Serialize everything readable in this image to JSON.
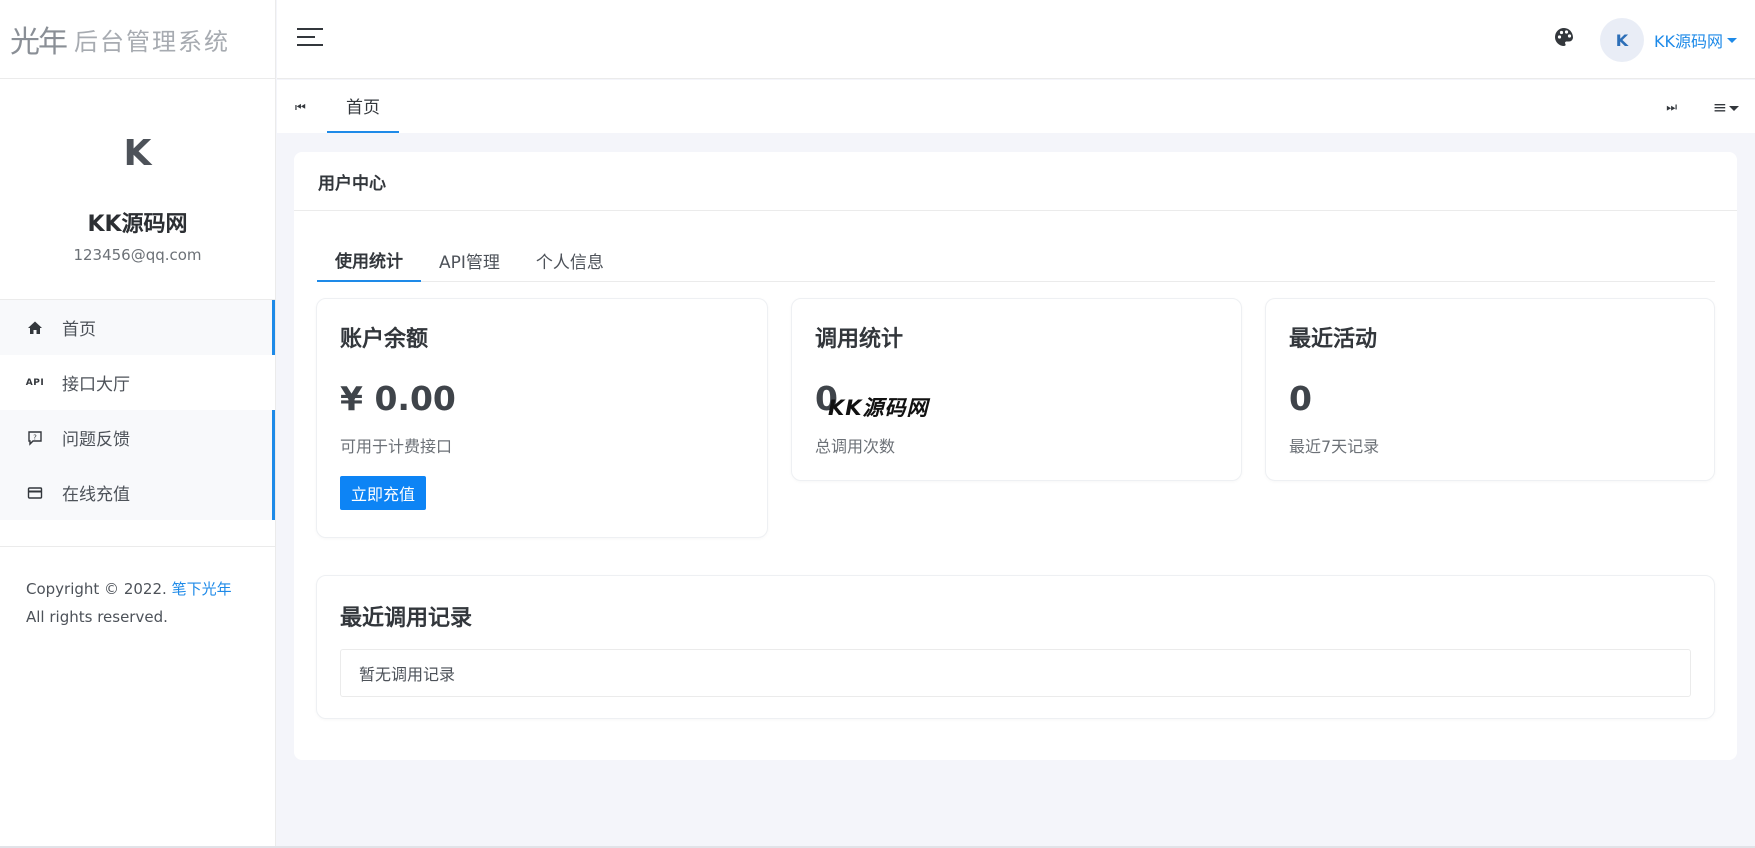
{
  "logo": {
    "glyph": "光年",
    "text": "后台管理系统"
  },
  "profile": {
    "initial": "K",
    "name": "KK源码网",
    "email": "123456@qq.com"
  },
  "sidebar": {
    "items": [
      {
        "label": "首页",
        "icon": "home-icon"
      },
      {
        "label": "接口大厅",
        "icon": "api-icon",
        "icon_text": "API"
      },
      {
        "label": "问题反馈",
        "icon": "feedback-icon"
      },
      {
        "label": "在线充值",
        "icon": "card-icon"
      }
    ]
  },
  "copyright": {
    "prefix": "Copyright © 2022.",
    "link": "笔下光年",
    "suffix": "All rights reserved."
  },
  "header": {
    "user_initial": "K",
    "user_name": "KK源码网"
  },
  "tabbar": {
    "prev": "⏮",
    "tab": "首页",
    "next": "⏭",
    "menu": "≡"
  },
  "panel": {
    "title": "用户中心"
  },
  "subtabs": [
    "使用统计",
    "API管理",
    "个人信息"
  ],
  "cards": {
    "balance": {
      "title": "账户余额",
      "value": "¥ 0.00",
      "desc": "可用于计费接口",
      "button": "立即充值"
    },
    "calls": {
      "title": "调用统计",
      "value": "0",
      "desc": "总调用次数"
    },
    "activity": {
      "title": "最近活动",
      "value": "0",
      "desc": "最近7天记录"
    }
  },
  "watermark": "KK源码网",
  "records": {
    "title": "最近调用记录",
    "empty": "暂无调用记录"
  },
  "colors": {
    "accent": "#1e8ae8",
    "button": "#0d84f5",
    "background": "#f4f5fa"
  }
}
